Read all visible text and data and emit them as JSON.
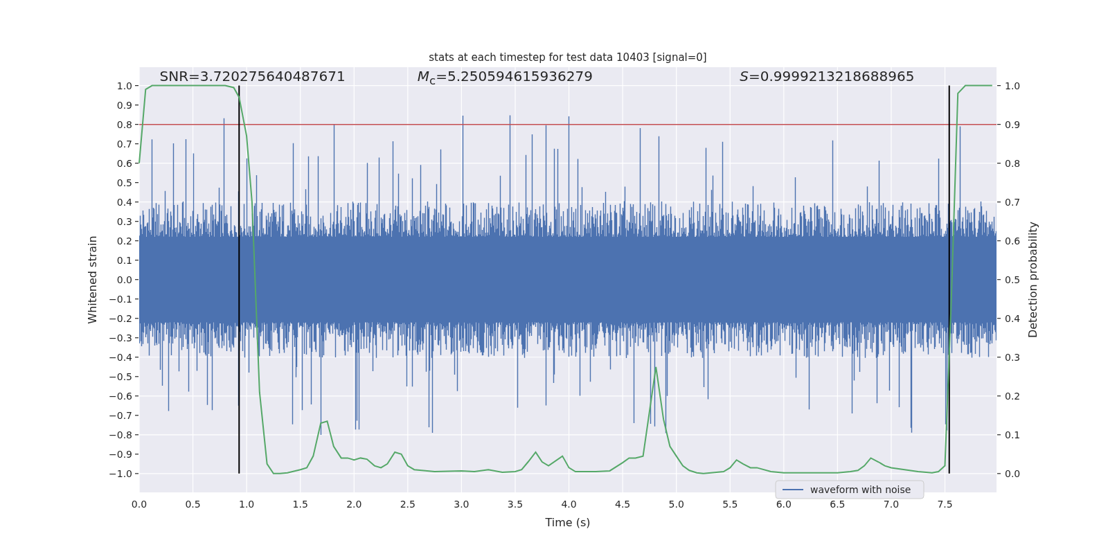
{
  "figure": {
    "chart_data": {
      "type": "line",
      "title": "stats at each timestep for test data 10403 [signal=0]",
      "xlabel": "Time (s)",
      "ylabel": "Whitened strain",
      "grid": true,
      "x": [
        0.0,
        0.06,
        0.12,
        0.8,
        0.88,
        0.93,
        1.0,
        1.05,
        1.12,
        1.19,
        1.25,
        1.31,
        1.38,
        1.5,
        1.56,
        1.62,
        1.69,
        1.75,
        1.81,
        1.88,
        1.94,
        2.0,
        2.06,
        2.12,
        2.19,
        2.25,
        2.31,
        2.38,
        2.44,
        2.5,
        2.56,
        2.75,
        3.0,
        3.12,
        3.25,
        3.38,
        3.5,
        3.56,
        3.62,
        3.69,
        3.75,
        3.81,
        3.94,
        4.0,
        4.06,
        4.25,
        4.38,
        4.5,
        4.56,
        4.62,
        4.69,
        4.75,
        4.81,
        4.88,
        4.94,
        5.0,
        5.06,
        5.12,
        5.19,
        5.25,
        5.44,
        5.5,
        5.56,
        5.62,
        5.69,
        5.75,
        5.88,
        6.0,
        6.5,
        6.62,
        6.69,
        6.75,
        6.81,
        6.88,
        6.94,
        7.0,
        7.25,
        7.38,
        7.44,
        7.5,
        7.56,
        7.62,
        7.69,
        7.94
      ],
      "series": [
        {
          "color": "#55a868",
          "values": [
            0.6,
            0.98,
            1.0,
            1.0,
            0.99,
            0.94,
            0.74,
            0.4,
            -0.58,
            -0.95,
            -1.0,
            -1.0,
            -0.996,
            -0.98,
            -0.97,
            -0.91,
            -0.74,
            -0.73,
            -0.86,
            -0.92,
            -0.92,
            -0.93,
            -0.92,
            -0.926,
            -0.96,
            -0.97,
            -0.95,
            -0.89,
            -0.9,
            -0.96,
            -0.98,
            -0.99,
            -0.986,
            -0.99,
            -0.98,
            -0.994,
            -0.99,
            -0.98,
            -0.94,
            -0.89,
            -0.94,
            -0.96,
            -0.91,
            -0.97,
            -0.99,
            -0.99,
            -0.986,
            -0.944,
            -0.92,
            -0.92,
            -0.91,
            -0.68,
            -0.45,
            -0.72,
            -0.86,
            -0.91,
            -0.96,
            -0.984,
            -0.996,
            -1.0,
            -0.99,
            -0.97,
            -0.93,
            -0.95,
            -0.97,
            -0.97,
            -0.99,
            -0.996,
            -0.996,
            -0.99,
            -0.984,
            -0.96,
            -0.92,
            -0.94,
            -0.96,
            -0.97,
            -0.99,
            -0.996,
            -0.99,
            -0.96,
            -0.1,
            0.96,
            1.0,
            1.0
          ]
        }
      ],
      "xlim": [
        0,
        7.98
      ],
      "ylim": [
        -1.097,
        1.095
      ],
      "xticks": [
        {
          "value": 0,
          "label": "0.0"
        },
        {
          "value": 0.5,
          "label": "0.5"
        },
        {
          "value": 1,
          "label": "1.0"
        },
        {
          "value": 1.5,
          "label": "1.5"
        },
        {
          "value": 2,
          "label": "2.0"
        },
        {
          "value": 2.5,
          "label": "2.5"
        },
        {
          "value": 3,
          "label": "3.0"
        },
        {
          "value": 3.5,
          "label": "3.5"
        },
        {
          "value": 4,
          "label": "4.0"
        },
        {
          "value": 4.5,
          "label": "4.5"
        },
        {
          "value": 5,
          "label": "5.0"
        },
        {
          "value": 5.5,
          "label": "5.5"
        },
        {
          "value": 6,
          "label": "6.0"
        },
        {
          "value": 6.5,
          "label": "6.5"
        },
        {
          "value": 7,
          "label": "7.0"
        },
        {
          "value": 7.5,
          "label": "7.5"
        }
      ],
      "yticks": [
        {
          "value": 1,
          "label": "1.0"
        },
        {
          "value": 0.9,
          "label": "0.9"
        },
        {
          "value": 0.8,
          "label": "0.8"
        },
        {
          "value": 0.7,
          "label": "0.7"
        },
        {
          "value": 0.6,
          "label": "0.6"
        },
        {
          "value": 0.5,
          "label": "0.5"
        },
        {
          "value": 0.4,
          "label": "0.4"
        },
        {
          "value": 0.3,
          "label": "0.3"
        },
        {
          "value": 0.2,
          "label": "0.2"
        },
        {
          "value": 0.1,
          "label": "0.1"
        },
        {
          "value": 0,
          "label": "0.0"
        },
        {
          "value": -0.1,
          "label": "−0.1"
        },
        {
          "value": -0.2,
          "label": "−0.2"
        },
        {
          "value": -0.3,
          "label": "−0.3"
        },
        {
          "value": -0.4,
          "label": "−0.4"
        },
        {
          "value": -0.5,
          "label": "−0.5"
        },
        {
          "value": -0.6,
          "label": "−0.6"
        },
        {
          "value": -0.7,
          "label": "−0.7"
        },
        {
          "value": -0.8,
          "label": "−0.8"
        },
        {
          "value": -0.9,
          "label": "−0.9"
        },
        {
          "value": -1,
          "label": "−1.0"
        }
      ],
      "ref_lines": [
        {
          "axis": "y",
          "value": 0.8,
          "color": "#c44e52"
        },
        {
          "axis": "x",
          "value": 0.93,
          "color": "#000000"
        },
        {
          "axis": "x",
          "value": 7.54,
          "color": "#000000"
        }
      ],
      "annotations": [
        "SNR=3.720275640487671",
        "*M*$_{c}$=5.250594615936279",
        "*S*=0.9999213218688965"
      ]
    },
    "right_axis": {
      "label": "Detection probability",
      "ticks": [
        "1.0",
        "0.9",
        "0.8",
        "0.7",
        "0.6",
        "0.5",
        "0.4",
        "0.3",
        "0.2",
        "0.1",
        "0.0"
      ]
    },
    "legend": [
      {
        "label": "waveform with noise",
        "color": "#4c72b0"
      }
    ]
  }
}
